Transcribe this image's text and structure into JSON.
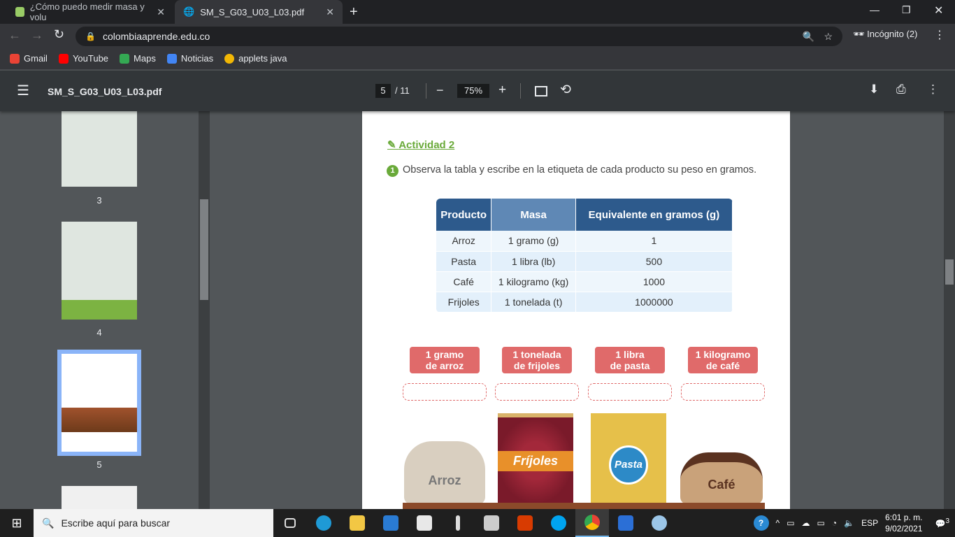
{
  "tabs": [
    {
      "label": "¿Cómo puedo medir masa y volu"
    },
    {
      "label": "SM_S_G03_U03_L03.pdf"
    }
  ],
  "address": "colombiaaprende.edu.co",
  "profile": "Incógnito (2)",
  "bookmarks": [
    {
      "label": "Gmail",
      "color": "#ea4335"
    },
    {
      "label": "YouTube",
      "color": "#ff0000"
    },
    {
      "label": "Maps",
      "color": "#34a853"
    },
    {
      "label": "Noticias",
      "color": "#4285f4"
    },
    {
      "label": "applets java",
      "color": "#f2b705"
    }
  ],
  "pdf": {
    "title": "SM_S_G03_U03_L03.pdf",
    "page": "5",
    "total": "/ 11",
    "zoom": "75%"
  },
  "thumbnails": [
    {
      "label": "3"
    },
    {
      "label": "4"
    },
    {
      "label": "5"
    }
  ],
  "doc": {
    "activity": "Actividad 2",
    "step": "1",
    "instruction": "Observa la tabla y escribe en la etiqueta de cada producto su peso en gramos.",
    "table": {
      "headers": [
        "Producto",
        "Masa",
        "Equivalente en gramos (g)"
      ],
      "rows": [
        [
          "Arroz",
          "1 gramo (g)",
          "1"
        ],
        [
          "Pasta",
          "1 libra (lb)",
          "500"
        ],
        [
          "Café",
          "1 kilogramo (kg)",
          "1000"
        ],
        [
          "Frijoles",
          "1 tonelada (t)",
          "1000000"
        ]
      ]
    },
    "labels": [
      {
        "l1": "1 gramo",
        "l2": "de arroz"
      },
      {
        "l1": "1 tonelada",
        "l2": "de frijoles"
      },
      {
        "l1": "1 libra",
        "l2": "de pasta"
      },
      {
        "l1": "1 kilogramo",
        "l2": "de café"
      }
    ],
    "products": [
      "Arroz",
      "Fríjoles",
      "Pasta",
      "Café"
    ]
  },
  "taskbar": {
    "search": "Escribe aquí para buscar",
    "lang": "ESP",
    "time": "6:01 p. m.",
    "date": "9/02/2021",
    "notifications": "3"
  }
}
